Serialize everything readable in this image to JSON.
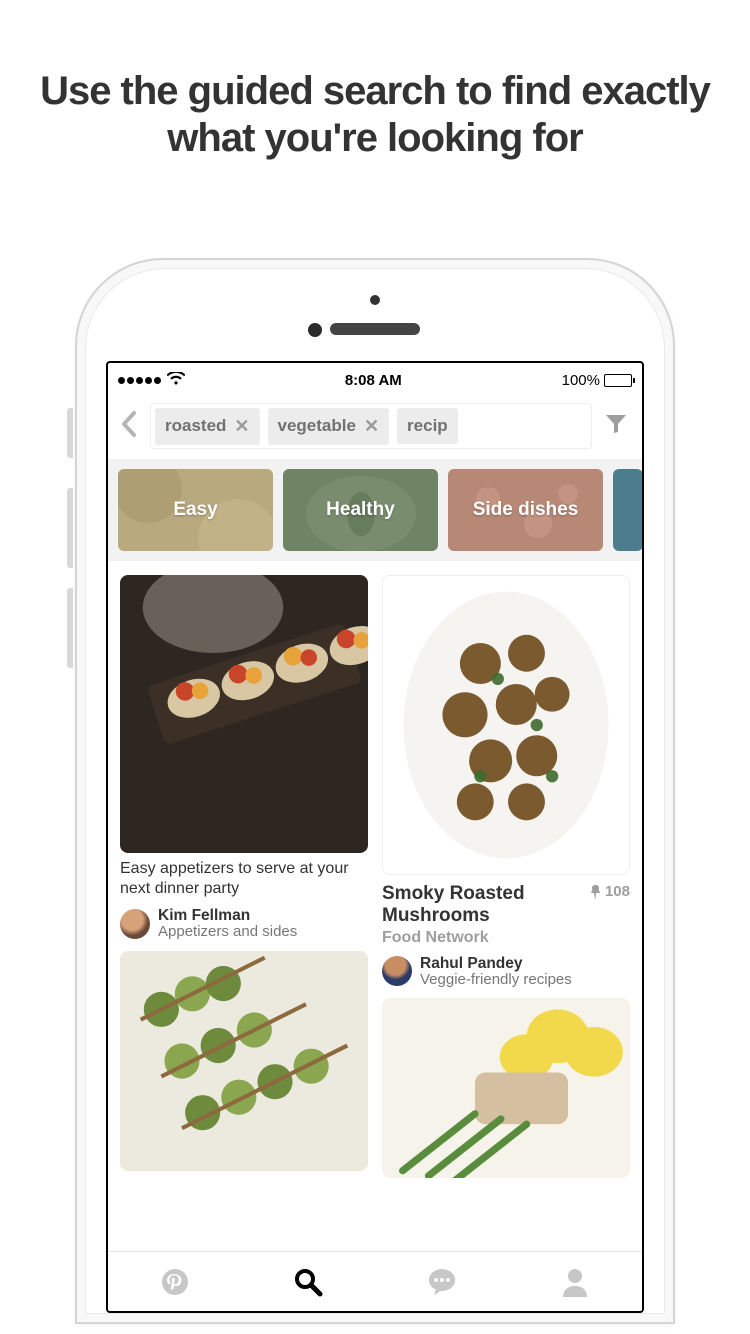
{
  "headline": "Use the guided search to find exactly what you're looking for",
  "status": {
    "time": "8:08 AM",
    "battery_pct": "100%"
  },
  "search": {
    "chips": [
      {
        "label": "roasted",
        "dismissible": true
      },
      {
        "label": "vegetable",
        "dismissible": true
      },
      {
        "label": "recip",
        "dismissible": false
      }
    ]
  },
  "guides": [
    {
      "label": "Easy",
      "bg": "#b8a97f"
    },
    {
      "label": "Healthy",
      "bg": "#6f8464"
    },
    {
      "label": "Side dishes",
      "bg": "#b78876"
    },
    {
      "label": "",
      "bg": "#4d7d8d"
    }
  ],
  "pins": [
    {
      "description": "Easy appetizers to serve at your next dinner party",
      "user_name": "Kim Fellman",
      "board": "Appetizers and sides"
    },
    {
      "title": "Smoky Roasted Mushrooms",
      "source": "Food Network",
      "pin_count": "108",
      "user_name": "Rahul Pandey",
      "board": "Veggie-friendly recipes"
    }
  ]
}
